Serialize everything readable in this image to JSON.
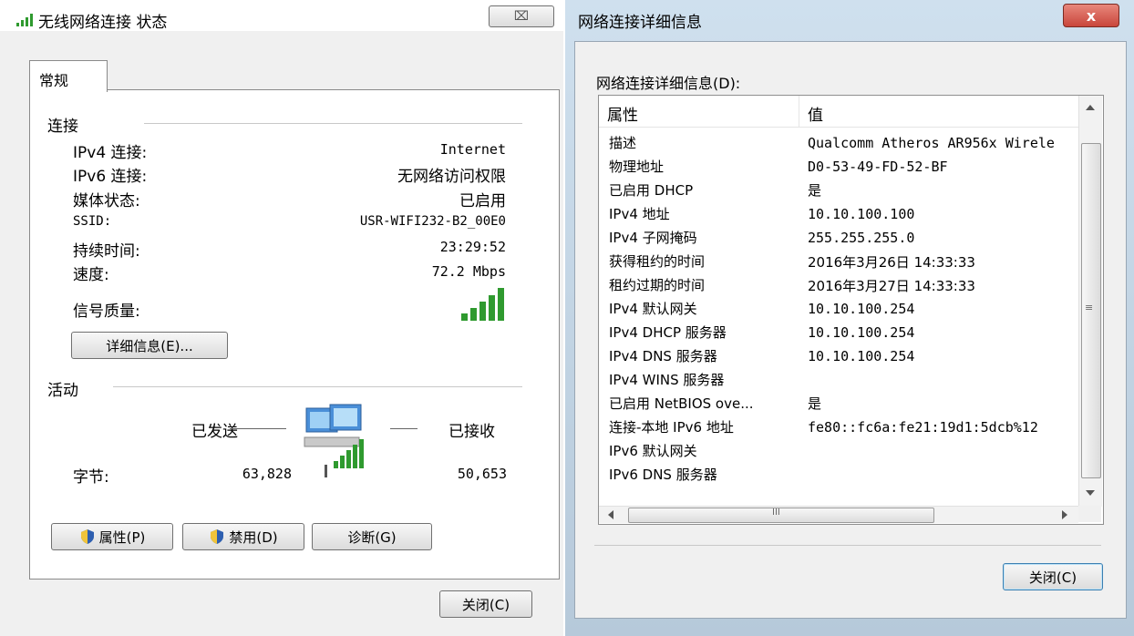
{
  "left": {
    "title": "无线网络连接 状态",
    "close_glyph": "⌧",
    "tab": "常规",
    "conn_group": "连接",
    "rows": [
      {
        "label": "IPv4 连接:",
        "value": "Internet"
      },
      {
        "label": "IPv6 连接:",
        "value": "无网络访问权限"
      },
      {
        "label": "媒体状态:",
        "value": "已启用"
      },
      {
        "label": "SSID:",
        "value": "USR-WIFI232-B2_00E0"
      },
      {
        "label": "持续时间:",
        "value": "23:29:52"
      },
      {
        "label": "速度:",
        "value": "72.2 Mbps"
      }
    ],
    "signal_label": "信号质量:",
    "details_button": "详细信息(E)...",
    "activity_group": "活动",
    "sent_label": "已发送",
    "recv_label": "已接收",
    "bytes_label": "字节:",
    "sent_bytes": "63,828",
    "recv_bytes": "50,653",
    "properties_button": "属性(P)",
    "disable_button": "禁用(D)",
    "diagnose_button": "诊断(G)",
    "close_button": "关闭(C)"
  },
  "right": {
    "title": "网络连接详细信息",
    "close_glyph": "x",
    "list_label": "网络连接详细信息(D):",
    "col_property": "属性",
    "col_value": "值",
    "rows": [
      {
        "p": "描述",
        "v": "Qualcomm Atheros AR956x Wirele"
      },
      {
        "p": "物理地址",
        "v": "D0-53-49-FD-52-BF"
      },
      {
        "p": "已启用 DHCP",
        "v": "是"
      },
      {
        "p": "IPv4 地址",
        "v": "10.10.100.100"
      },
      {
        "p": "IPv4 子网掩码",
        "v": "255.255.255.0"
      },
      {
        "p": "获得租约的时间",
        "v": "2016年3月26日 14:33:33"
      },
      {
        "p": "租约过期的时间",
        "v": "2016年3月27日 14:33:33"
      },
      {
        "p": "IPv4 默认网关",
        "v": "10.10.100.254"
      },
      {
        "p": "IPv4 DHCP 服务器",
        "v": "10.10.100.254"
      },
      {
        "p": "IPv4 DNS 服务器",
        "v": "10.10.100.254"
      },
      {
        "p": "IPv4 WINS 服务器",
        "v": ""
      },
      {
        "p": "已启用 NetBIOS ove...",
        "v": "是"
      },
      {
        "p": "连接-本地 IPv6 地址",
        "v": "fe80::fc6a:fe21:19d1:5dcb%12"
      },
      {
        "p": "IPv6 默认网关",
        "v": ""
      },
      {
        "p": "IPv6 DNS 服务器",
        "v": ""
      }
    ],
    "scroll_mid": "III",
    "vscroll_mid": "≡",
    "close_button": "关闭(C)"
  },
  "colors": {
    "signal_green": "#2f9a2f",
    "close_red": "#c9463b",
    "shield_blue": "#2e5fb0",
    "shield_yellow": "#f0c43a"
  }
}
